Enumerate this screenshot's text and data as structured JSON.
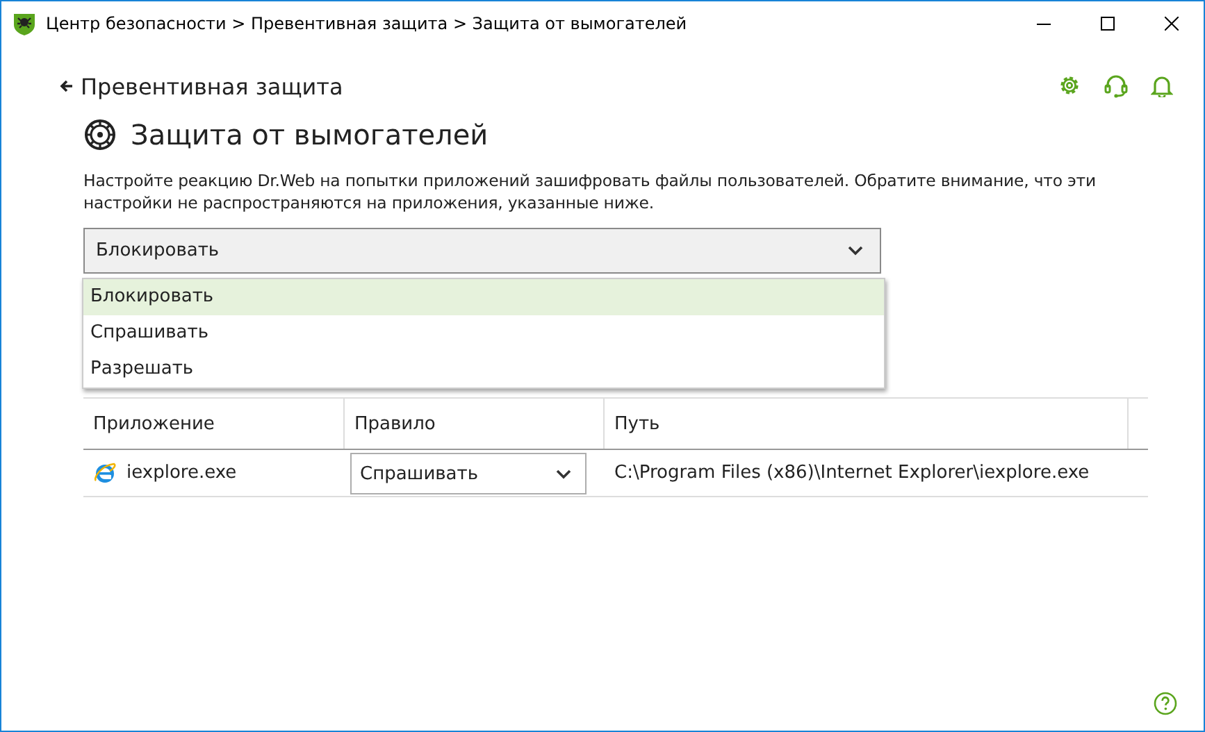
{
  "window": {
    "title": "Центр безопасности > Превентивная защита > Защита от вымогателей"
  },
  "back_link": {
    "label": "Превентивная защита"
  },
  "heading": "Защита от вымогателей",
  "description": "Настройте реакцию Dr.Web на попытки приложений зашифровать файлы пользователей. Обратите внимание, что эти настройки не распространяются на приложения, указанные ниже.",
  "action_select": {
    "value": "Блокировать",
    "expanded": true,
    "options": [
      {
        "label": "Блокировать",
        "selected": true
      },
      {
        "label": "Спрашивать",
        "selected": false
      },
      {
        "label": "Разрешать",
        "selected": false
      }
    ]
  },
  "table": {
    "columns": [
      "Приложение",
      "Правило",
      "Путь"
    ],
    "rows": [
      {
        "application": "iexplore.exe",
        "rule": "Спрашивать",
        "path": "C:\\Program Files (x86)\\Internet Explorer\\iexplore.exe"
      }
    ]
  }
}
